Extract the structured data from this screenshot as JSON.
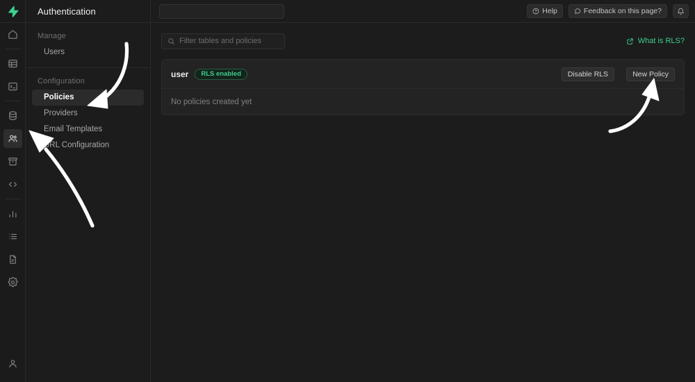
{
  "brand": {
    "logo_icon": "supabase-lightning-bolt",
    "accent": "#3ecf8e"
  },
  "rail": {
    "items": [
      {
        "name": "home",
        "icon": "home-icon",
        "active": false
      },
      {
        "name": "table-editor",
        "icon": "table-icon",
        "active": false
      },
      {
        "name": "sql-editor",
        "icon": "terminal-icon",
        "active": false
      },
      {
        "name": "database",
        "icon": "database-icon",
        "active": false
      },
      {
        "name": "authentication",
        "icon": "users-icon",
        "active": true
      },
      {
        "name": "storage",
        "icon": "archive-icon",
        "active": false
      },
      {
        "name": "api",
        "icon": "code-icon",
        "active": false
      },
      {
        "name": "reports",
        "icon": "bar-chart-icon",
        "active": false
      },
      {
        "name": "logs",
        "icon": "list-icon",
        "active": false
      },
      {
        "name": "api-docs",
        "icon": "document-icon",
        "active": false
      },
      {
        "name": "project-settings",
        "icon": "gear-icon",
        "active": false
      }
    ],
    "account_icon": "user-avatar-icon"
  },
  "sidebar": {
    "title": "Authentication",
    "sections": [
      {
        "label": "Manage",
        "items": [
          {
            "label": "Users",
            "active": false
          }
        ]
      },
      {
        "label": "Configuration",
        "items": [
          {
            "label": "Policies",
            "active": true
          },
          {
            "label": "Providers",
            "active": false
          },
          {
            "label": "Email Templates",
            "active": false
          },
          {
            "label": "URL Configuration",
            "active": false
          }
        ]
      }
    ]
  },
  "topbar": {
    "omnibar_value": "",
    "omnibar_placeholder": "",
    "help_label": "Help",
    "help_icon": "question-circle-icon",
    "feedback_label": "Feedback on this page?",
    "feedback_icon": "chat-bubble-icon",
    "notifications_icon": "bell-icon"
  },
  "content": {
    "filter_value": "",
    "filter_placeholder": "Filter tables and policies",
    "search_icon": "search-icon",
    "rls_link_label": "What is RLS?",
    "rls_link_icon": "external-link-icon",
    "card": {
      "table_name": "user",
      "rls_badge": "RLS enabled",
      "disable_rls_label": "Disable RLS",
      "new_policy_label": "New Policy",
      "empty_state": "No policies created yet"
    }
  },
  "annotations": {
    "arrow_color": "#ffffff",
    "arrows": [
      {
        "name": "arrow-to-policies",
        "target": "Policies"
      },
      {
        "name": "arrow-to-auth-rail-icon",
        "target": "Authentication rail icon"
      },
      {
        "name": "arrow-to-new-policy",
        "target": "New Policy"
      }
    ]
  }
}
